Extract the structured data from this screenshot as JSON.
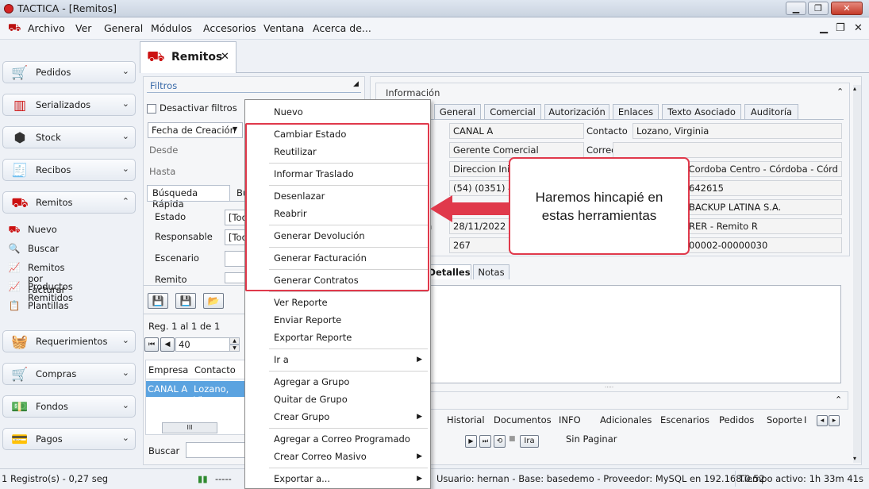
{
  "window": {
    "title": "TACTICA - [Remitos]",
    "min": "▁",
    "max": "❐",
    "close": "✕"
  },
  "menubar": {
    "items": [
      "Archivo",
      "Ver",
      "General",
      "Módulos",
      "Accesorios",
      "Ventana",
      "Acerca de..."
    ],
    "mdi_min": "▁",
    "mdi_restore": "❐",
    "mdi_close": "✕"
  },
  "nav": {
    "groups": [
      {
        "label": "Pedidos",
        "icon": "shopping-cart-icon",
        "glyph": "🛒",
        "chev": "⌄"
      },
      {
        "label": "Serializados",
        "icon": "barcode-icon",
        "glyph": "▥",
        "chev": "⌄"
      },
      {
        "label": "Stock",
        "icon": "box-icon",
        "glyph": "⬢",
        "chev": "⌄"
      },
      {
        "label": "Recibos",
        "icon": "receipt-icon",
        "glyph": "🧾",
        "chev": "⌄"
      },
      {
        "label": "Remitos",
        "icon": "hand-truck-icon",
        "glyph": "⛟",
        "chev": "⌃"
      },
      {
        "label": "Requerimientos",
        "icon": "basket-icon",
        "glyph": "🧺",
        "chev": "⌄"
      },
      {
        "label": "Compras",
        "icon": "cart-icon",
        "glyph": "🛒",
        "chev": "⌄"
      },
      {
        "label": "Fondos",
        "icon": "money-icon",
        "glyph": "💵",
        "chev": "⌄"
      },
      {
        "label": "Pagos",
        "icon": "payment-icon",
        "glyph": "💳",
        "chev": "⌄"
      }
    ],
    "remitos_items": [
      {
        "label": "Nuevo",
        "icon": "new-icon",
        "glyph": "⛟"
      },
      {
        "label": "Buscar",
        "icon": "search-icon",
        "glyph": "🔍"
      },
      {
        "label": "Remitos por Facturar",
        "icon": "chart-icon",
        "glyph": "📈"
      },
      {
        "label": "Productos Remitidos",
        "icon": "chart-icon",
        "glyph": "📈"
      },
      {
        "label": "Plantillas",
        "icon": "template-icon",
        "glyph": "📋"
      }
    ]
  },
  "doc_tab": {
    "label": "Remitos",
    "close": "✕",
    "glyph": "⛟"
  },
  "filters": {
    "title": "Filtros",
    "collapse": "◢",
    "deactivate": "Desactivar filtros",
    "date_field": "Fecha de Creación",
    "dropdown_arrow": "▼",
    "desde": "Desde",
    "hasta": "Hasta",
    "tab_quick": "Búsqueda Rápida",
    "tab_adv": "Bú",
    "rows": [
      {
        "label": "Estado",
        "value": "[Tod"
      },
      {
        "label": "Responsable",
        "value": "[Tod"
      },
      {
        "label": "Escenario",
        "value": ""
      },
      {
        "label": "Remito",
        "value": ""
      }
    ],
    "btn_save": "💾",
    "btn_save2": "💾",
    "btn_open": "📂",
    "reg": "Reg. 1 al 1 de 1",
    "nav_first": "⏮",
    "nav_prev": "◀",
    "page_size": "40",
    "spin_up": "▲",
    "spin_down": "▼",
    "grid_headers": [
      "Empresa",
      "Contacto"
    ],
    "grid_row": [
      "CANAL A",
      "Lozano, Virg"
    ],
    "hscroll": "III",
    "search_label": "Buscar"
  },
  "main": {
    "info_title": "Información",
    "info_chev": "⌃",
    "tabs": [
      "General",
      "Comercial",
      "Autorización",
      "Enlaces",
      "Texto Asociado",
      "Auditoría"
    ],
    "fields": {
      "empresa": "CANAL A",
      "cargo": "Gerente Comercial",
      "direccion": "Direccion Inicial",
      "telefono": "(54) (0351) 456",
      "fecha_label": "n",
      "fecha": "28/11/2022",
      "numero": "267",
      "contacto_label": "Contacto",
      "contacto": "Lozano, Virginia",
      "correo_label": "Correo",
      "correo": "",
      "dir_right": "4500 - Cordoba Centro - Córdoba - Córd",
      "tel_right": "642615",
      "empresa_right": "BACKUP LATINA S.A.",
      "tipo_right": "RER - Remito R",
      "nro_right": "00002-00000030"
    },
    "subtabs": [
      "Detalles",
      "Notas"
    ],
    "bottom_tabs": [
      "Historial",
      "Documentos",
      "INFO",
      "Adicionales",
      "Escenarios",
      "Pedidos",
      "Soporte",
      "I"
    ],
    "bottom_nav": [
      "▶",
      "⏭",
      "⟲",
      "■",
      "Ira"
    ],
    "sin_paginar": "Sin Paginar",
    "splitter": "·····",
    "scroll_left": "◂",
    "scroll_right": "▸",
    "scroll_up": "▴",
    "scroll_down": "▾"
  },
  "context_menu": {
    "items": [
      {
        "label": "Nuevo",
        "sub": false
      },
      {
        "label": "Cambiar Estado",
        "sub": false
      },
      {
        "label": "Reutilizar",
        "sub": false
      },
      {
        "label": "Informar Traslado",
        "sub": false
      },
      {
        "label": "Desenlazar",
        "sub": false
      },
      {
        "label": "Reabrir",
        "sub": false
      },
      {
        "label": "Generar Devolución",
        "sub": false
      },
      {
        "label": "Generar Facturación",
        "sub": false
      },
      {
        "label": "Generar Contratos",
        "sub": false
      },
      {
        "label": "Ver Reporte",
        "sub": false
      },
      {
        "label": "Enviar Reporte",
        "sub": false
      },
      {
        "label": "Exportar Reporte",
        "sub": false
      },
      {
        "label": "Ir a",
        "sub": true
      },
      {
        "label": "Agregar a Grupo",
        "sub": false
      },
      {
        "label": "Quitar de Grupo",
        "sub": false
      },
      {
        "label": "Crear Grupo",
        "sub": true
      },
      {
        "label": "Agregar a Correo Programado",
        "sub": false
      },
      {
        "label": "Crear Correo Masivo",
        "sub": true
      },
      {
        "label": "Exportar a...",
        "sub": true
      }
    ],
    "arrow": "▶"
  },
  "callout": {
    "text": "Haremos hincapié en estas herramientas"
  },
  "status": {
    "records": "1 Registro(s) - 0,27 seg",
    "dashes": "-----",
    "user_info": "Usuario: hernan - Base: basedemo - Proveedor: MySQL en 192.168.0.52",
    "active_time": "Tiempo activo: 1h 33m 41s"
  },
  "colors": {
    "accent": "#e0394b",
    "selection": "#5ba3e0",
    "link": "#3869a8"
  }
}
